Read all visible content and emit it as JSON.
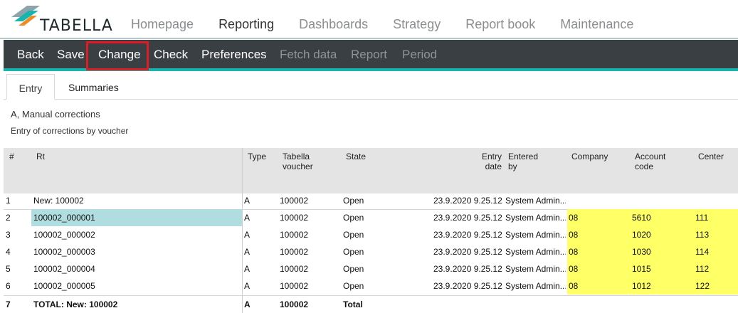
{
  "brand": {
    "name": "TABELLA"
  },
  "top_nav": [
    "Homepage",
    "Reporting",
    "Dashboards",
    "Strategy",
    "Report book",
    "Maintenance"
  ],
  "toolbar": {
    "back": "Back",
    "save": "Save",
    "change": "Change",
    "check": "Check",
    "preferences": "Preferences",
    "fetch_data": "Fetch data",
    "report": "Report",
    "period": "Period"
  },
  "tabs": {
    "entry": "Entry",
    "summaries": "Summaries"
  },
  "description": {
    "line1": "A, Manual corrections",
    "line2": "Entry of corrections by voucher"
  },
  "columns": {
    "num": "#",
    "rt": "Rt",
    "type": "Type",
    "voucher_1": "Tabella",
    "voucher_2": "voucher",
    "state": "State",
    "entry_date_1": "Entry",
    "entry_date_2": "date",
    "entered_by_1": "Entered",
    "entered_by_2": "by",
    "company": "Company",
    "account_1": "Account",
    "account_2": "code",
    "center": "Center"
  },
  "rows": [
    {
      "num": "1",
      "rt": "New: 100002",
      "type": "A",
      "voucher": "100002",
      "state": "Open",
      "entry_date": "23.9.2020 9.25.12",
      "entered_by": "System Admin...",
      "company": "",
      "account": "",
      "center": ""
    },
    {
      "num": "2",
      "rt": "100002_000001",
      "type": "A",
      "voucher": "100002",
      "state": "Open",
      "entry_date": "23.9.2020 9.25.12",
      "entered_by": "System Admin...",
      "company": "08",
      "account": "5610",
      "center": "111"
    },
    {
      "num": "3",
      "rt": "100002_000002",
      "type": "A",
      "voucher": "100002",
      "state": "Open",
      "entry_date": "23.9.2020 9.25.12",
      "entered_by": "System Admin...",
      "company": "08",
      "account": "1020",
      "center": "113"
    },
    {
      "num": "4",
      "rt": "100002_000003",
      "type": "A",
      "voucher": "100002",
      "state": "Open",
      "entry_date": "23.9.2020 9.25.12",
      "entered_by": "System Admin...",
      "company": "08",
      "account": "1030",
      "center": "114"
    },
    {
      "num": "5",
      "rt": "100002_000004",
      "type": "A",
      "voucher": "100002",
      "state": "Open",
      "entry_date": "23.9.2020 9.25.12",
      "entered_by": "System Admin...",
      "company": "08",
      "account": "1015",
      "center": "112"
    },
    {
      "num": "6",
      "rt": "100002_000005",
      "type": "A",
      "voucher": "100002",
      "state": "Open",
      "entry_date": "23.9.2020 9.25.12",
      "entered_by": "System Admin...",
      "company": "08",
      "account": "1012",
      "center": "122"
    },
    {
      "num": "7",
      "rt": "TOTAL: New: 100002",
      "type": "A",
      "voucher": "100002",
      "state": "Total",
      "entry_date": "",
      "entered_by": "",
      "company": "",
      "account": "",
      "center": ""
    }
  ],
  "colors": {
    "toolbar_bg": "#3a3f43",
    "toolbar_accent": "#17b5b0",
    "highlight_box": "#e01b24",
    "editable_cell": "#ffff66",
    "selected_cell": "#b0dde0"
  }
}
